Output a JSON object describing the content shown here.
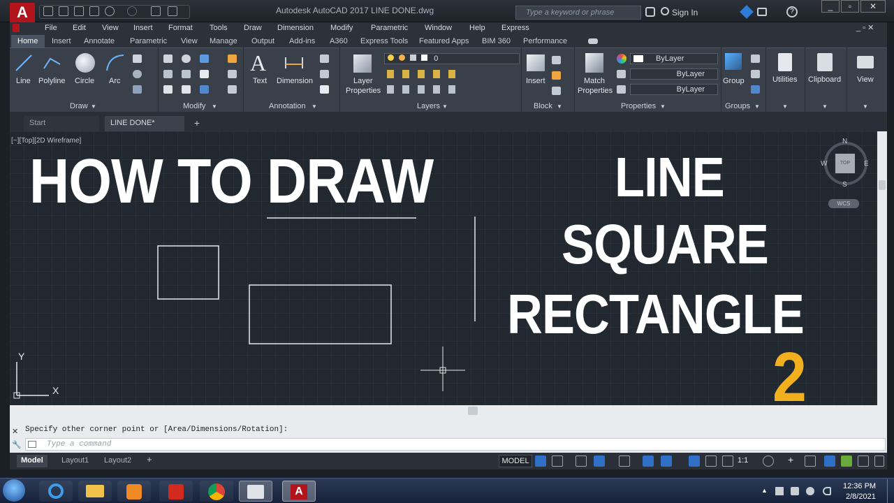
{
  "title_bar": {
    "app_logo": "A",
    "window_title": "Autodesk AutoCAD 2017    LINE DONE.dwg",
    "search_placeholder": "Type a keyword or phrase",
    "sign_in": "Sign In"
  },
  "menu": [
    "File",
    "Edit",
    "View",
    "Insert",
    "Format",
    "Tools",
    "Draw",
    "Dimension",
    "Modify",
    "Parametric",
    "Window",
    "Help",
    "Express"
  ],
  "ribbon_tabs": [
    "Home",
    "Insert",
    "Annotate",
    "Parametric",
    "View",
    "Manage",
    "Output",
    "Add-ins",
    "A360",
    "Express Tools",
    "Featured Apps",
    "BIM 360",
    "Performance"
  ],
  "ribbon": {
    "draw": {
      "title": "Draw",
      "tools": [
        "Line",
        "Polyline",
        "Circle",
        "Arc"
      ]
    },
    "modify": {
      "title": "Modify"
    },
    "annotation": {
      "title": "Annotation",
      "tools": [
        "Text",
        "Dimension"
      ]
    },
    "layers": {
      "title": "Layers",
      "tool_line1": "Layer",
      "tool_line2": "Properties",
      "current_layer": "0"
    },
    "block": {
      "title": "Block",
      "tool": "Insert"
    },
    "properties": {
      "title": "Properties",
      "tool_line1": "Match",
      "tool_line2": "Properties",
      "color": "ByLayer",
      "linetype": "ByLayer",
      "lineweight": "ByLayer"
    },
    "groups": {
      "title": "Groups",
      "tool": "Group"
    },
    "utilities": {
      "tool": "Utilities"
    },
    "clipboard": {
      "tool": "Clipboard"
    },
    "view": {
      "tool": "View"
    }
  },
  "file_tabs": [
    "Start",
    "LINE DONE*"
  ],
  "viewport_label": "[−][Top][2D Wireframe]",
  "overlay": {
    "heading_left": "HOW TO DRAW",
    "line1": "LINE",
    "line2": "SQUARE",
    "line3": "RECTANGLE",
    "number": "2"
  },
  "viewcube": {
    "n": "N",
    "s": "S",
    "e": "E",
    "w": "W",
    "top": "TOP",
    "wcs": "WCS"
  },
  "ucs": {
    "x": "X",
    "y": "Y"
  },
  "command": {
    "history": "Specify other corner point or [Area/Dimensions/Rotation]:",
    "placeholder": "Type a command"
  },
  "layout_tabs": [
    "Model",
    "Layout1",
    "Layout2"
  ],
  "status": {
    "model": "MODEL",
    "scale": "1:1"
  },
  "clock": {
    "time": "12:36 PM",
    "date": "2/8/2021"
  },
  "colors": {
    "accent": "#b3141b",
    "overlay_number": "#f2b01e",
    "canvas": "#212830"
  }
}
